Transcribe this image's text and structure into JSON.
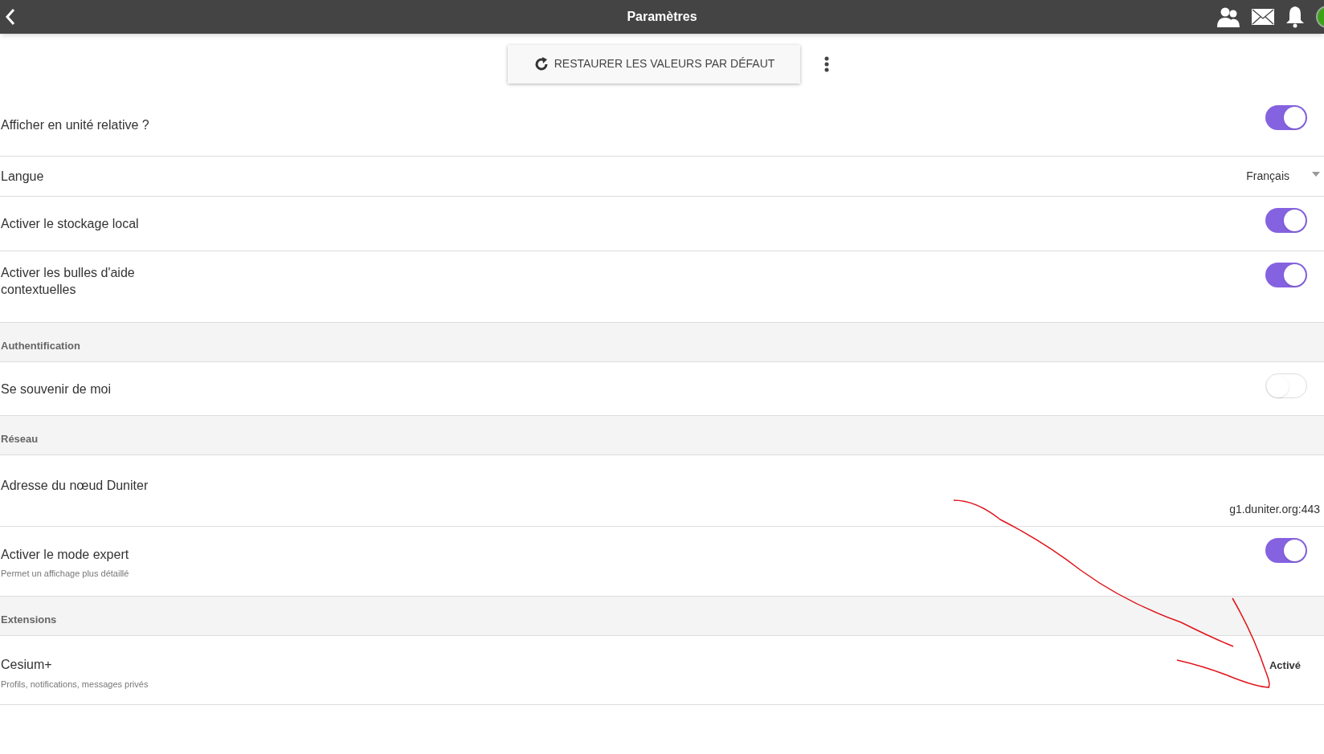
{
  "header": {
    "title": "Paramètres"
  },
  "toolbar": {
    "restore_button": "RESTAURER LES VALEURS PAR DÉFAUT"
  },
  "rows": [
    {
      "kind": "toggle",
      "label": "Afficher en unité relative ?",
      "on": true
    },
    {
      "kind": "select",
      "label": "Langue",
      "value": "Français"
    },
    {
      "kind": "toggle",
      "label": "Activer le stockage local",
      "on": true
    },
    {
      "kind": "toggle",
      "label": "Activer les bulles d'aide contextuelles",
      "on": true
    },
    {
      "kind": "divider",
      "label": "Authentification"
    },
    {
      "kind": "toggle",
      "label": "Se souvenir de moi",
      "on": false
    },
    {
      "kind": "divider",
      "label": "Réseau"
    },
    {
      "kind": "value",
      "label": "Adresse du nœud Duniter",
      "value": "g1.duniter.org:443"
    },
    {
      "kind": "toggle",
      "label": "Activer le mode expert",
      "note": "Permet un affichage plus détaillé",
      "on": true
    },
    {
      "kind": "divider",
      "label": "Extensions"
    },
    {
      "kind": "status",
      "label": "Cesium+",
      "note": "Profils, notifications, messages privés",
      "value": "Activé"
    }
  ]
}
